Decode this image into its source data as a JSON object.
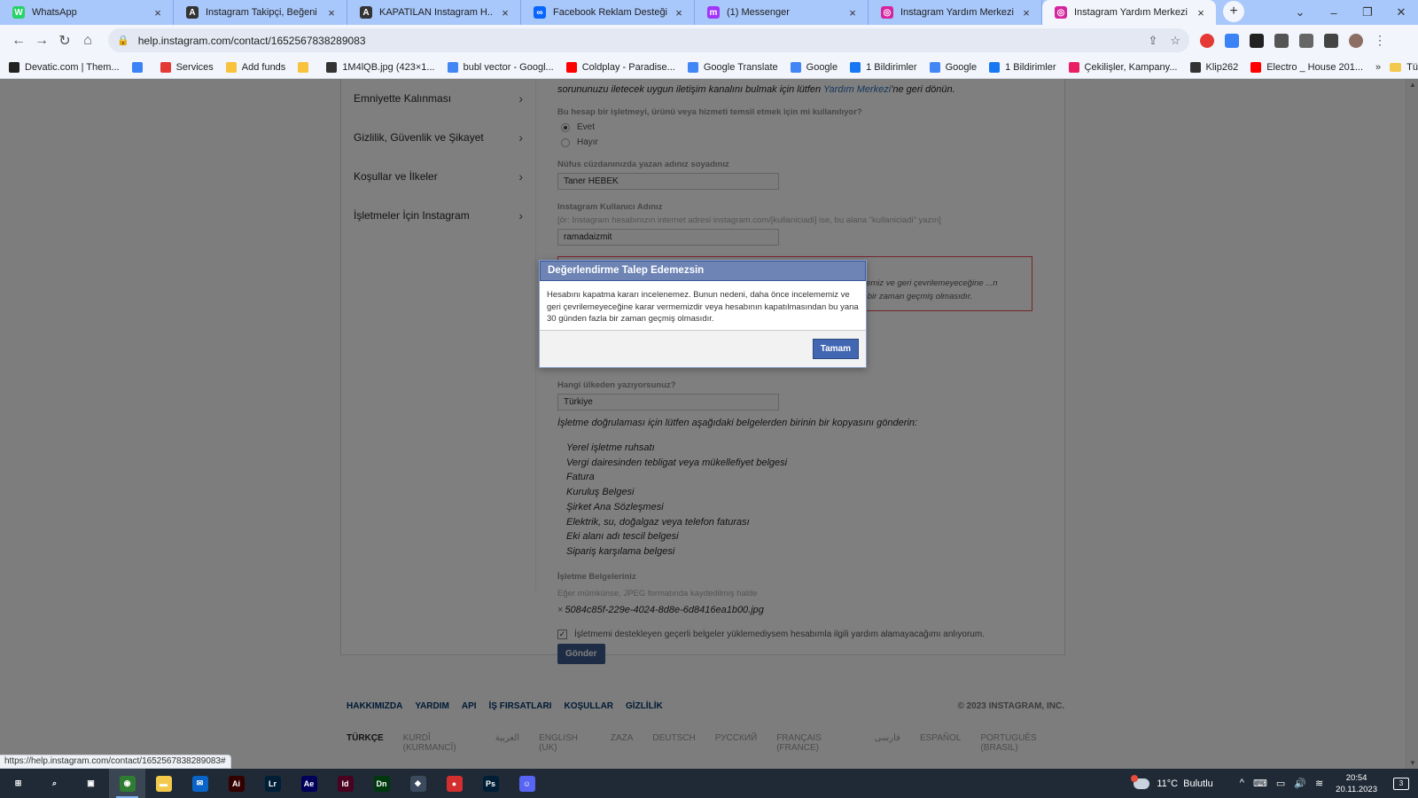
{
  "tabs": [
    {
      "title": "WhatsApp",
      "icon": "whatsapp-icon",
      "color": "#25d366",
      "glyph": "W"
    },
    {
      "title": "Instagram Takipçi, Beğeni Satın",
      "icon": "instagram-seller-icon",
      "color": "#333333",
      "glyph": "A"
    },
    {
      "title": "KAPATILAN Instagram H...",
      "icon": "instagram-seller-icon",
      "color": "#333333",
      "glyph": "A"
    },
    {
      "title": "Facebook Reklam Desteği | Met",
      "icon": "meta-icon",
      "color": "#0866ff",
      "glyph": "∞"
    },
    {
      "title": "(1) Messenger",
      "icon": "messenger-icon",
      "color": "#a334fa",
      "glyph": "m"
    },
    {
      "title": "Instagram Yardım Merkezi",
      "icon": "instagram-icon",
      "color": "#d6249f",
      "glyph": "◎"
    },
    {
      "title": "Instagram Yardım Merkezi",
      "icon": "instagram-icon",
      "color": "#d6249f",
      "glyph": "◎"
    }
  ],
  "tab_close": "×",
  "new_tab": "+",
  "window_controls": {
    "dropdown": "⌄",
    "minimize": "–",
    "restore": "❐",
    "close": "✕"
  },
  "nav": {
    "back": "←",
    "forward": "→",
    "reload": "↻",
    "home": "⌂"
  },
  "address": {
    "url": "help.instagram.com/contact/1652567838289083",
    "lock": "🔒",
    "share": "⇪",
    "star": "☆"
  },
  "bookmarks": [
    {
      "label": "Devatic.com | Them...",
      "color": "#222222"
    },
    {
      "label": "",
      "color": "#3b82f6"
    },
    {
      "label": "Services",
      "color": "#e53935"
    },
    {
      "label": "Add funds",
      "color": "#f9c23c"
    },
    {
      "label": "",
      "color": "#f9c23c"
    },
    {
      "label": "1M4lQB.jpg (423×1...",
      "color": "#333333"
    },
    {
      "label": "bubl vector - Googl...",
      "color": "#4285f4"
    },
    {
      "label": "Coldplay - Paradise...",
      "color": "#ff0000"
    },
    {
      "label": "Google Translate",
      "color": "#4285f4"
    },
    {
      "label": "Google",
      "color": "#4285f4"
    },
    {
      "label": "1 Bildirimler",
      "color": "#1877f2"
    },
    {
      "label": "Google",
      "color": "#4285f4"
    },
    {
      "label": "1 Bildirimler",
      "color": "#1877f2"
    },
    {
      "label": "Çekilişler, Kampany...",
      "color": "#e91e63"
    },
    {
      "label": "Klip262",
      "color": "#333333"
    },
    {
      "label": "Electro _ House 201...",
      "color": "#ff0000"
    }
  ],
  "bookmarks_more": "»",
  "bookmarks_folder": "Tüm Yer İşaretleri",
  "sidebar": {
    "items": [
      {
        "label": "Emniyette Kalınması"
      },
      {
        "label": "Gizlilik, Güvenlik ve Şikayet"
      },
      {
        "label": "Koşullar ve İlkeler"
      },
      {
        "label": "İşletmeler İçin Instagram"
      }
    ],
    "chevron": "›"
  },
  "form": {
    "intro_prefix": "sorununuzu iletecek uygun iletişim kanalını bulmak için lütfen ",
    "intro_link": "Yardım Merkezi",
    "intro_suffix": "'ne geri dönün.",
    "q_business": "Bu hesap bir işletmeyi, ürünü veya hizmeti temsil etmek için mi kullanılıyor?",
    "radio_yes": "Evet",
    "radio_no": "Hayır",
    "q_fullname": "Nüfus cüzdanınızda yazan adınız soyadınız",
    "fullname_value": "Taner HEBEK",
    "q_username": "Instagram Kullanıcı Adınız",
    "username_hint": "[ör: Instagram hesabınızın internet adresi instagram.com/[kullaniciadi] ise, bu alana \"kullaniciadi\" yazın]",
    "username_value": "ramadaizmit",
    "error_text": "...ememiz ve geri çevrilemeyeceğine ...n fazla bir zaman geçmiş olmasıdır.",
    "q_country": "Hangi ülkeden yazıyorsunuz?",
    "country_value": "Türkiye",
    "docs_intro": "İşletme doğrulaması için lütfen aşağıdaki belgelerden birinin bir kopyasını gönderin:",
    "docs": [
      "Yerel işletme ruhsatı",
      "Vergi dairesinden tebligat veya mükellefiyet belgesi",
      "Fatura",
      "Kuruluş Belgesi",
      "Şirket Ana Sözleşmesi",
      "Elektrik, su, doğalgaz veya telefon faturası",
      "Eki alanı adı tescil belgesi",
      "Sipariş karşılama belgesi"
    ],
    "q_docs": "İşletme Belgeleriniz",
    "docs_hint": "Eğer mümkünse, JPEG formatında kaydedilmiş halde",
    "file_remove": "×",
    "file_name": "5084c85f-229e-4024-8d8e-6d8416ea1b00.jpg",
    "checkbox_mark": "✓",
    "checkbox_label": "İşletmemi destekleyen geçerli belgeler yüklemediysem hesabımla ilgili yardım alamayacağımı anlıyorum.",
    "submit_label": "Gönder"
  },
  "footer": {
    "links": [
      "HAKKIMIZDA",
      "YARDIM",
      "API",
      "İŞ FIRSATLARI",
      "KOŞULLAR",
      "GİZLİLİK"
    ],
    "copyright": "© 2023 INSTAGRAM, INC.",
    "languages": [
      "TÜRKÇE",
      "KURDÎ (KURMANCÎ)",
      "العربية",
      "ENGLISH (UK)",
      "ZAZA",
      "DEUTSCH",
      "РУССКИЙ",
      "FRANÇAIS (FRANCE)",
      "فارسی",
      "ESPAÑOL",
      "PORTUGUÊS (BRASIL)"
    ]
  },
  "modal": {
    "title": "Değerlendirme Talep Edemezsin",
    "body": "Hesabını kapatma kararı incelenemez. Bunun nedeni, daha önce incelememiz ve geri çevrilemeyeceğine karar vermemizdir veya hesabının kapatılmasından bu yana 30 günden fazla bir zaman geçmiş olmasıdır.",
    "ok_label": "Tamam"
  },
  "status_url": "https://help.instagram.com/contact/1652567838289083#",
  "taskbar": {
    "apps": [
      {
        "name": "start",
        "glyph": "⊞",
        "color": "#1f2a36"
      },
      {
        "name": "search",
        "glyph": "⌕",
        "color": "#1f2a36"
      },
      {
        "name": "task-view",
        "glyph": "▣",
        "color": "#1f2a36"
      },
      {
        "name": "chrome",
        "glyph": "◉",
        "color": "#2e7d32"
      },
      {
        "name": "file-explorer",
        "glyph": "▬",
        "color": "#f3c94d"
      },
      {
        "name": "mail",
        "glyph": "✉",
        "color": "#0a64c8"
      },
      {
        "name": "illustrator",
        "glyph": "Ai",
        "color": "#330000"
      },
      {
        "name": "lightroom",
        "glyph": "Lr",
        "color": "#001e36"
      },
      {
        "name": "after-effects",
        "glyph": "Ae",
        "color": "#00005b"
      },
      {
        "name": "indesign",
        "glyph": "Id",
        "color": "#49021f"
      },
      {
        "name": "dimension",
        "glyph": "Dn",
        "color": "#00380e"
      },
      {
        "name": "davinci",
        "glyph": "◆",
        "color": "#3b4a5c"
      },
      {
        "name": "photo-app",
        "glyph": "●",
        "color": "#d32f2f"
      },
      {
        "name": "photoshop",
        "glyph": "Ps",
        "color": "#001e36"
      },
      {
        "name": "discord",
        "glyph": "☺",
        "color": "#5865f2"
      }
    ],
    "weather_temp": "11°C",
    "weather_text": "Bulutlu",
    "tray_icons": [
      "^",
      "⌨",
      "▭",
      "🔊",
      "≋"
    ],
    "time": "20:54",
    "date": "20.11.2023",
    "notifications": "3"
  }
}
